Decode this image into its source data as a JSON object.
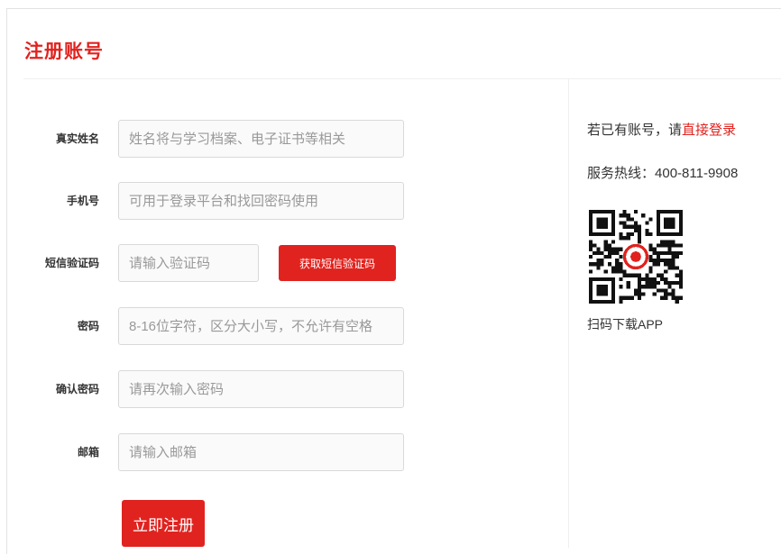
{
  "page": {
    "title": "注册账号"
  },
  "form": {
    "fields": [
      {
        "label": "真实姓名",
        "placeholder": "姓名将与学习档案、电子证书等相关",
        "value": ""
      },
      {
        "label": "手机号",
        "placeholder": "可用于登录平台和找回密码使用",
        "value": ""
      },
      {
        "label": "短信验证码",
        "placeholder": "请输入验证码",
        "value": ""
      },
      {
        "label": "密码",
        "placeholder": "8-16位字符，区分大小写，不允许有空格",
        "value": ""
      },
      {
        "label": "确认密码",
        "placeholder": "请再次输入密码",
        "value": ""
      },
      {
        "label": "邮箱",
        "placeholder": "请输入邮箱",
        "value": ""
      }
    ],
    "sms_button_label": "获取短信验证码",
    "submit_label": "立即注册"
  },
  "side": {
    "login_prefix": "若已有账号，请",
    "login_link": "直接登录",
    "hotline_label": "服务热线：",
    "hotline_number": "400-811-9908",
    "qr_caption": "扫码下载APP",
    "qr_icon": "qr-code-icon"
  },
  "colors": {
    "accent": "#e0231f",
    "text": "#333333",
    "placeholder": "#999999",
    "border": "#d9d9d9"
  }
}
